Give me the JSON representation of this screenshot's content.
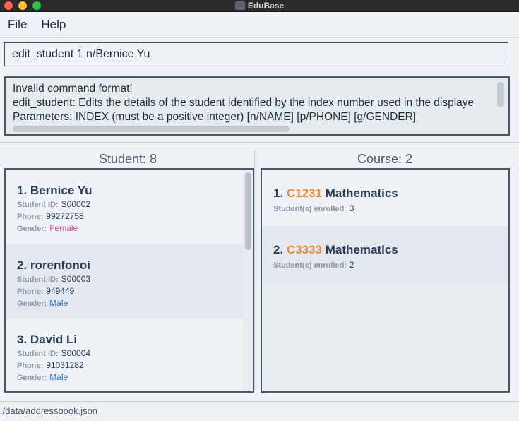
{
  "window": {
    "title": "EduBase"
  },
  "menu": {
    "file": "File",
    "help": "Help"
  },
  "command": {
    "value": "edit_student 1 n/Bernice Yu"
  },
  "result": {
    "lines": [
      "Invalid command format!",
      "edit_student: Edits the details of the student identified by the index number used in the displaye",
      "Parameters: INDEX (must be a positive integer) [n/NAME] [p/PHONE] [g/GENDER]"
    ]
  },
  "students": {
    "title": "Student: 8",
    "items": [
      {
        "index": "1.",
        "name": "Bernice Yu",
        "id_label": "Student ID:",
        "id": "S00002",
        "phone_label": "Phone:",
        "phone": "99272758",
        "gender_label": "Gender:",
        "gender": "Female"
      },
      {
        "index": "2.",
        "name": "rorenfonoi",
        "id_label": "Student ID:",
        "id": "S00003",
        "phone_label": "Phone:",
        "phone": "949449",
        "gender_label": "Gender:",
        "gender": "Male"
      },
      {
        "index": "3.",
        "name": "David Li",
        "id_label": "Student ID:",
        "id": "S00004",
        "phone_label": "Phone:",
        "phone": "91031282",
        "gender_label": "Gender:",
        "gender": "Male"
      }
    ]
  },
  "courses": {
    "title": "Course: 2",
    "items": [
      {
        "index": "1.",
        "code": "C1231",
        "name": "Mathematics",
        "enrolled_label": "Student(s) enrolled:",
        "enrolled": "3"
      },
      {
        "index": "2.",
        "code": "C3333",
        "name": "Mathematics",
        "enrolled_label": "Student(s) enrolled:",
        "enrolled": "2"
      }
    ]
  },
  "status": {
    "path": "./data/addressbook.json"
  },
  "colors": {
    "accent_code": "#f08c32",
    "female": "#d94f8c",
    "male": "#2f6fd6"
  }
}
